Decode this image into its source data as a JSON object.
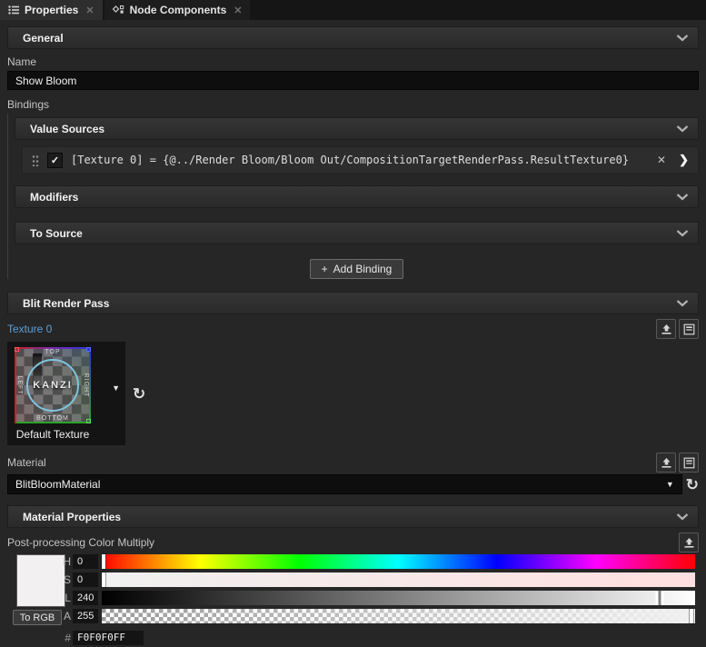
{
  "tabs": {
    "properties": {
      "label": "Properties",
      "close": "✕"
    },
    "node_components": {
      "label": "Node Components",
      "close": "✕"
    }
  },
  "sections": {
    "general": "General",
    "value_sources": "Value Sources",
    "modifiers": "Modifiers",
    "to_source": "To Source",
    "blit_render_pass": "Blit Render Pass",
    "material_properties": "Material Properties"
  },
  "general": {
    "name_label": "Name",
    "name_value": "Show Bloom"
  },
  "bindings": {
    "label": "Bindings",
    "checkbox_check": "✓",
    "expression": "[Texture 0] = {@../Render Bloom/Bloom Out/CompositionTargetRenderPass.ResultTexture0}",
    "remove_label": "✕",
    "open_label": "❯",
    "add_button_plus": "+",
    "add_button_label": "Add Binding"
  },
  "blit": {
    "texture_label": "Texture 0",
    "texture_name": "Default Texture",
    "dropdown_arrow": "▼",
    "refresh_glyph": "↻",
    "material_label": "Material",
    "material_value": "BlitBloomMaterial"
  },
  "texture_preview": {
    "brand": "KANZI",
    "top": "TOP",
    "bottom": "BOTTOM",
    "left": "LEFT",
    "right": "RIGHT"
  },
  "material_properties": {
    "color_label": "Post-processing Color Multiply"
  },
  "color_picker": {
    "channels": [
      {
        "label": "H",
        "value": "0"
      },
      {
        "label": "S",
        "value": "0"
      },
      {
        "label": "L",
        "value": "240"
      },
      {
        "label": "A",
        "value": "255"
      }
    ],
    "to_rgb_label": "To RGB",
    "hex_label": "#",
    "hex_value": "F0F0F0FF",
    "swatch_color": "#F2F0F0",
    "swatch_style": "background:#F2F0F0"
  },
  "colors": {
    "accent_blue": "#5B9FD9",
    "panel_background": "#262626",
    "header_background": "#2E2E2E",
    "input_background": "#0E0E0E"
  }
}
